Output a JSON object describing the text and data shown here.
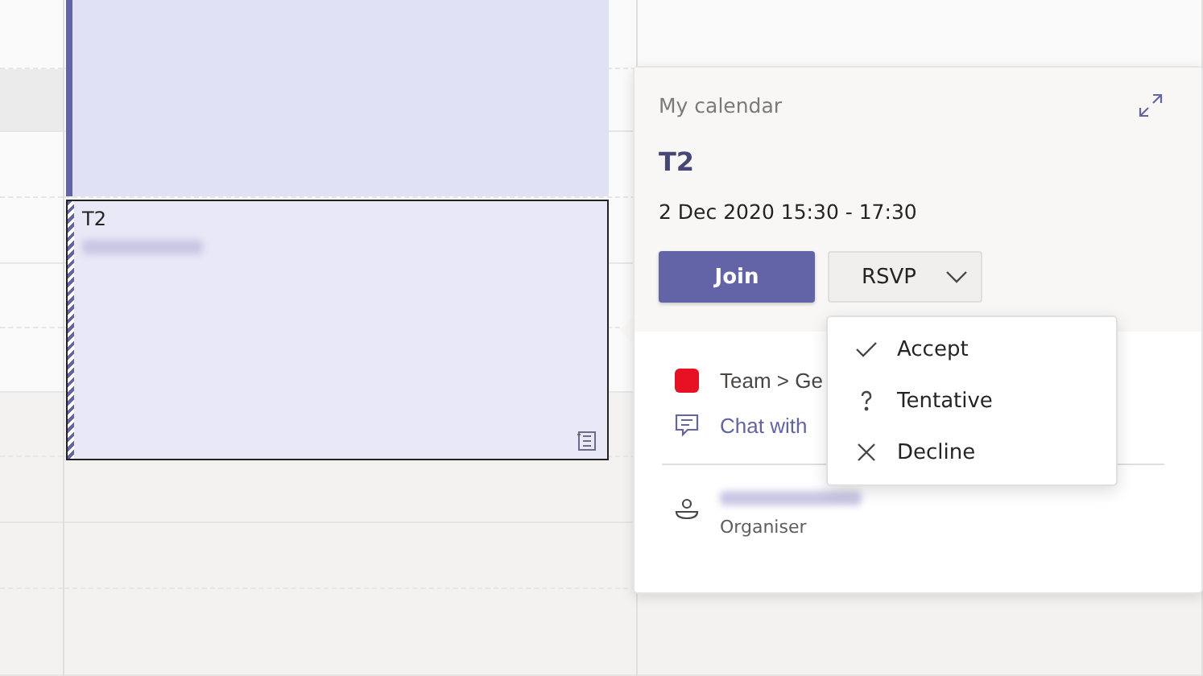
{
  "calendar": {
    "events": [
      {
        "kind": "plain",
        "selected": false
      },
      {
        "title": "T2",
        "kind": "tentative",
        "selected": true
      }
    ]
  },
  "popover": {
    "calendar_name": "My calendar",
    "title": "T2",
    "when": "2 Dec 2020 15:30 - 17:30",
    "join_button": "Join",
    "rsvp_button": "RSVP",
    "channel": "Team > Ge",
    "chat_link": "Chat with",
    "organiser_role": "Organiser"
  },
  "rsvp_menu": [
    {
      "label": "Accept",
      "kind": "check"
    },
    {
      "label": "Tentative",
      "kind": "question"
    },
    {
      "label": "Decline",
      "kind": "cross"
    }
  ]
}
